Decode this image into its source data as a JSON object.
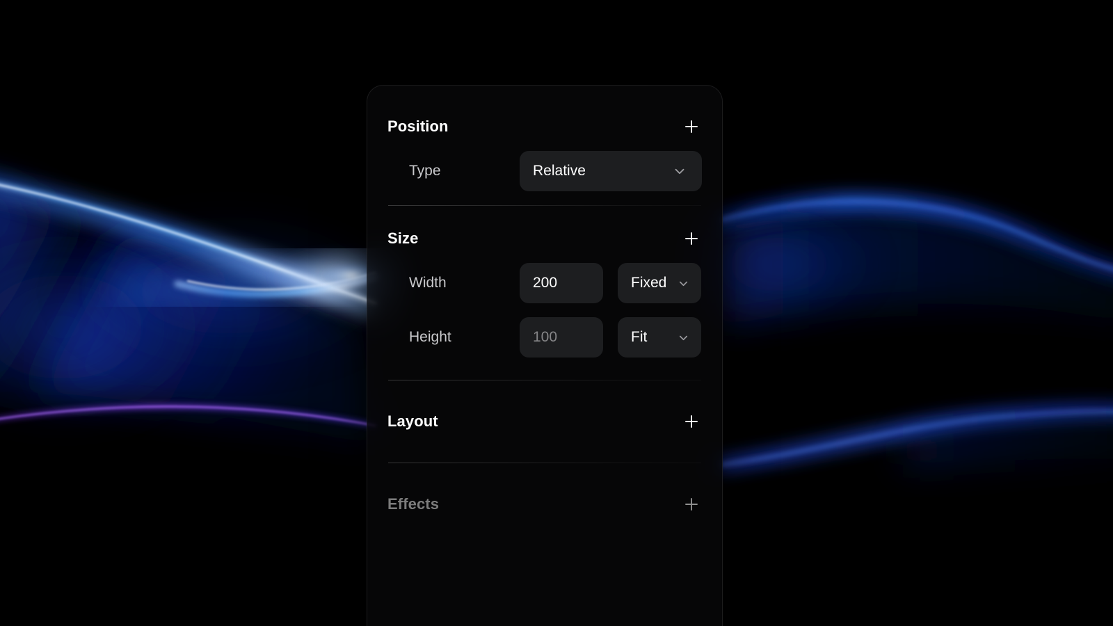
{
  "panel": {
    "sections": [
      {
        "id": "position",
        "title": "Position",
        "add_icon": "plus-icon",
        "enabled": true,
        "rows": [
          {
            "id": "type",
            "label": "Type",
            "select": {
              "value": "Relative",
              "chevron_icon": "chevron-down-icon"
            }
          }
        ]
      },
      {
        "id": "size",
        "title": "Size",
        "add_icon": "plus-icon",
        "enabled": true,
        "rows": [
          {
            "id": "width",
            "label": "Width",
            "input": {
              "value": "200",
              "placeholder": "200",
              "is_placeholder": false
            },
            "select": {
              "value": "Fixed",
              "chevron_icon": "chevron-down-icon"
            }
          },
          {
            "id": "height",
            "label": "Height",
            "input": {
              "value": "",
              "placeholder": "100",
              "is_placeholder": true
            },
            "select": {
              "value": "Fit",
              "chevron_icon": "chevron-down-icon"
            }
          }
        ]
      },
      {
        "id": "layout",
        "title": "Layout",
        "add_icon": "plus-icon",
        "enabled": true,
        "rows": []
      },
      {
        "id": "effects",
        "title": "Effects",
        "add_icon": "plus-icon",
        "enabled": false,
        "rows": []
      }
    ]
  },
  "colors": {
    "background": "#000000",
    "panel_fill": "#08080a",
    "field_fill": "#1d1e20",
    "text_primary": "#ffffff",
    "text_secondary": "#c9c9cc",
    "text_placeholder": "#868688",
    "text_disabled": "#7c7c7c",
    "wave_blue": "#1d4ed8",
    "wave_bright": "#7fb8ff",
    "wave_purple": "#8b3ff5"
  },
  "background": {
    "description": "abstract-glowing-wave-lines"
  }
}
